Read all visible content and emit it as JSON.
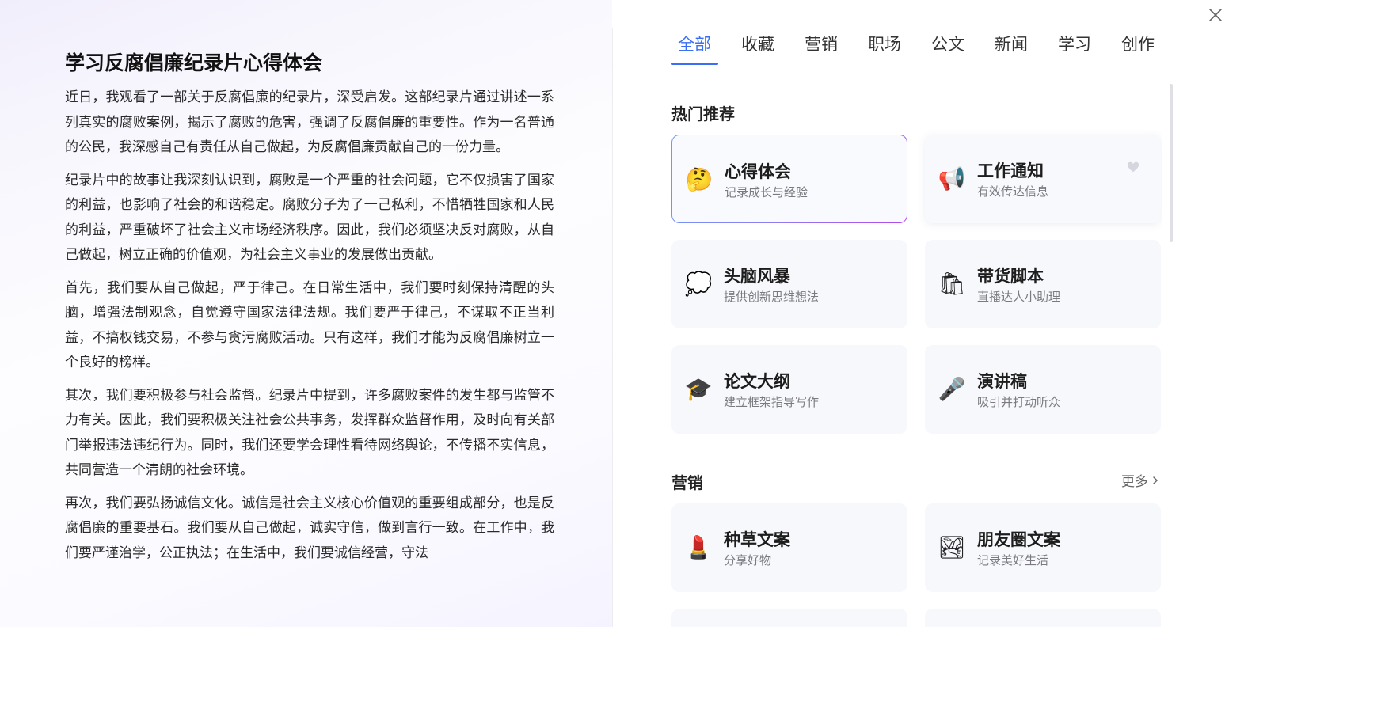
{
  "article": {
    "title": "学习反腐倡廉纪录片心得体会",
    "paragraphs": [
      "近日，我观看了一部关于反腐倡廉的纪录片，深受启发。这部纪录片通过讲述一系列真实的腐败案例，揭示了腐败的危害，强调了反腐倡廉的重要性。作为一名普通的公民，我深感自己有责任从自己做起，为反腐倡廉贡献自己的一份力量。",
      "纪录片中的故事让我深刻认识到，腐败是一个严重的社会问题，它不仅损害了国家的利益，也影响了社会的和谐稳定。腐败分子为了一己私利，不惜牺牲国家和人民的利益，严重破坏了社会主义市场经济秩序。因此，我们必须坚决反对腐败，从自己做起，树立正确的价值观，为社会主义事业的发展做出贡献。",
      "首先，我们要从自己做起，严于律己。在日常生活中，我们要时刻保持清醒的头脑，增强法制观念，自觉遵守国家法律法规。我们要严于律己，不谋取不正当利益，不搞权钱交易，不参与贪污腐败活动。只有这样，我们才能为反腐倡廉树立一个良好的榜样。",
      "其次，我们要积极参与社会监督。纪录片中提到，许多腐败案件的发生都与监管不力有关。因此，我们要积极关注社会公共事务，发挥群众监督作用，及时向有关部门举报违法违纪行为。同时，我们还要学会理性看待网络舆论，不传播不实信息，共同营造一个清朗的社会环境。",
      "再次，我们要弘扬诚信文化。诚信是社会主义核心价值观的重要组成部分，也是反腐倡廉的重要基石。我们要从自己做起，诚实守信，做到言行一致。在工作中，我们要严谨治学，公正执法；在生活中，我们要诚信经营，守法"
    ]
  },
  "tabs": [
    {
      "label": "全部",
      "active": true
    },
    {
      "label": "收藏",
      "active": false
    },
    {
      "label": "营销",
      "active": false
    },
    {
      "label": "职场",
      "active": false
    },
    {
      "label": "公文",
      "active": false
    },
    {
      "label": "新闻",
      "active": false
    },
    {
      "label": "学习",
      "active": false
    },
    {
      "label": "创作",
      "active": false
    }
  ],
  "hot": {
    "title": "热门推荐",
    "cards": [
      {
        "title": "心得体会",
        "desc": "记录成长与经验",
        "icon": "thinking-face-icon",
        "glyph": "🤔"
      },
      {
        "title": "工作通知",
        "desc": "有效传达信息",
        "icon": "megaphone-icon",
        "glyph": "📢"
      },
      {
        "title": "头脑风暴",
        "desc": "提供创新思维想法",
        "icon": "thought-balloon-icon",
        "glyph": "💭"
      },
      {
        "title": "带货脚本",
        "desc": "直播达人小助理",
        "icon": "shopping-bags-icon",
        "glyph": "🛍"
      },
      {
        "title": "论文大纲",
        "desc": "建立框架指导写作",
        "icon": "graduation-cap-icon",
        "glyph": "🎓"
      },
      {
        "title": "演讲稿",
        "desc": "吸引并打动听众",
        "icon": "microphone-icon",
        "glyph": "🎤"
      }
    ]
  },
  "marketing": {
    "title": "营销",
    "more": "更多",
    "cards": [
      {
        "title": "种草文案",
        "desc": "分享好物",
        "icon": "lipstick-icon",
        "glyph": "💄"
      },
      {
        "title": "朋友圈文案",
        "desc": "记录美好生活",
        "icon": "landscape-picture-icon",
        "glyph": "🏞"
      }
    ]
  },
  "colors": {
    "accent": "#3b6ef5",
    "card_bg": "#f7f8fc",
    "selected_border_start": "#6a9cf6",
    "selected_border_end": "#b24ae8"
  }
}
